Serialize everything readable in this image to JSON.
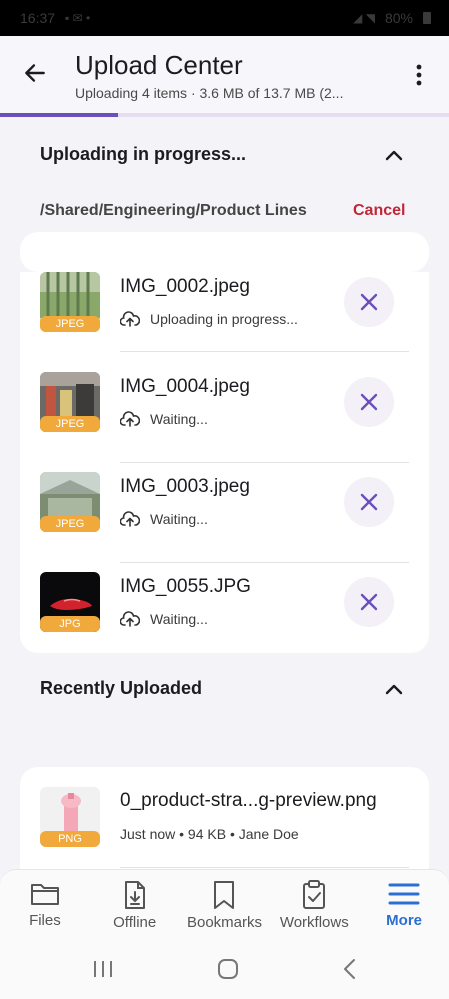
{
  "status_bar": {
    "time": "16:37",
    "battery": "80%"
  },
  "header": {
    "title": "Upload Center",
    "subtitle": "Uploading 4 items · 3.6 MB of 13.7 MB (2...",
    "progress_fraction": 0.263
  },
  "uploading": {
    "section_title": "Uploading in progress...",
    "path": "/Shared/Engineering/Product Lines",
    "cancel_label": "Cancel",
    "items": [
      {
        "name": "IMG_0002.jpeg",
        "badge": "JPEG",
        "status": "Uploading in progress..."
      },
      {
        "name": "IMG_0004.jpeg",
        "badge": "JPEG",
        "status": "Waiting..."
      },
      {
        "name": "IMG_0003.jpeg",
        "badge": "JPEG",
        "status": "Waiting..."
      },
      {
        "name": "IMG_0055.JPG",
        "badge": "JPG",
        "status": "Waiting..."
      }
    ]
  },
  "recent": {
    "section_title": "Recently Uploaded",
    "items": [
      {
        "name": "0_product-stra...g-preview.png",
        "badge": "PNG",
        "meta": "Just now • 94 KB • Jane Doe"
      }
    ]
  },
  "bottom_nav": {
    "items": [
      {
        "label": "Files",
        "icon": "folder-icon"
      },
      {
        "label": "Offline",
        "icon": "offline-file-icon"
      },
      {
        "label": "Bookmarks",
        "icon": "bookmark-icon"
      },
      {
        "label": "Workflows",
        "icon": "clipboard-check-icon"
      },
      {
        "label": "More",
        "icon": "hamburger-menu-icon",
        "active": true
      }
    ]
  },
  "colors": {
    "accent": "#6b4fbb",
    "cancel": "#c0283a",
    "badge": "#f2a93b",
    "active_nav": "#2a6fd1"
  }
}
